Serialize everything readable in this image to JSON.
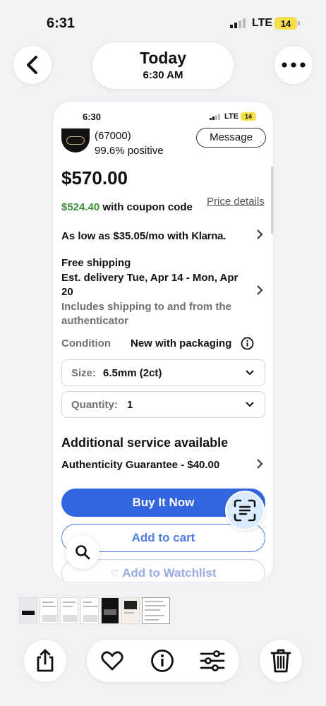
{
  "status_bar": {
    "time": "6:31",
    "network": "LTE",
    "battery": "14"
  },
  "header": {
    "title": "Today",
    "subtitle": "6:30 AM"
  },
  "screenshot": {
    "status_bar": {
      "time": "6:30",
      "network": "LTE",
      "battery": "14"
    },
    "seller": {
      "feedback_count": "(67000)",
      "positive": "99.6% positive",
      "message_label": "Message"
    },
    "price": "$570.00",
    "coupon": {
      "amount": "$524.40",
      "text": " with coupon code",
      "details_label": "Price details"
    },
    "financing": {
      "prefix": "As low as $35.05/mo with ",
      "provider": "Klarna."
    },
    "shipping": {
      "title": "Free shipping",
      "delivery_line1": "Est. delivery Tue, Apr 14 - Mon, Apr",
      "delivery_line2": "20",
      "note_line1": "Includes shipping to and from the",
      "note_line2": "authenticator"
    },
    "condition": {
      "label": "Condition",
      "value": "New with packaging"
    },
    "size": {
      "label": "Size:",
      "value": "6.5mm (2ct)"
    },
    "quantity": {
      "label": "Quantity:",
      "value": "1"
    },
    "service": {
      "heading": "Additional service available",
      "item": "Authenticity Guarantee - $40.00"
    },
    "buttons": {
      "buy": "Buy It Now",
      "cart": "Add to cart",
      "watch": "Add to Watchlist"
    }
  },
  "colors": {
    "accent": "#3465e0",
    "green": "#3c8f3a",
    "battery": "#f5df4d"
  },
  "icons": [
    "back-icon",
    "more-icon",
    "scan-text-icon",
    "search-icon",
    "share-icon",
    "heart-icon",
    "info-icon",
    "adjust-icon",
    "trash-icon"
  ]
}
